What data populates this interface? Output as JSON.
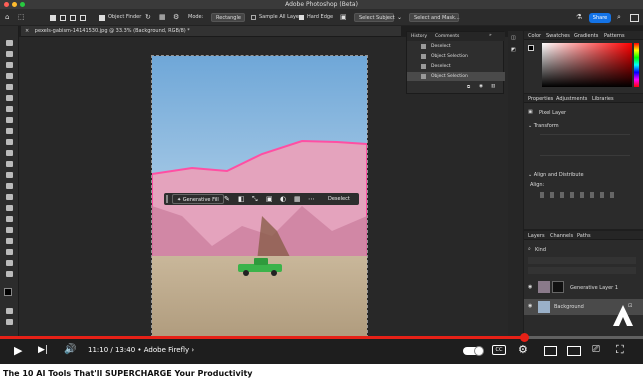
{
  "window": {
    "title": "Adobe Photoshop (Beta)"
  },
  "options": {
    "object_finder": "Object Finder",
    "mode_label": "Mode:",
    "mode_value": "Rectangle",
    "sample_all_layers": "Sample All Layers",
    "hard_edge": "Hard Edge",
    "select_subject": "Select Subject",
    "select_and_mask": "Select and Mask..."
  },
  "share_label": "Share",
  "document": {
    "tab_title": "pexels-gabism-14141530.jpg @ 33.3% (Background, RGB/8) *"
  },
  "history": {
    "tabs": [
      "History",
      "Comments"
    ],
    "items": [
      "Deselect",
      "Object Selection",
      "Deselect",
      "Object Selection"
    ]
  },
  "contextual_bar": {
    "generative_fill": "Generative Fill",
    "deselect": "Deselect"
  },
  "color_panel": {
    "tabs": [
      "Color",
      "Swatches",
      "Gradients",
      "Patterns"
    ]
  },
  "properties": {
    "tabs": [
      "Properties",
      "Adjustments",
      "Libraries"
    ],
    "layer_type": "Pixel Layer",
    "transform": "Transform",
    "align": "Align and Distribute",
    "align_label": "Align:"
  },
  "layers": {
    "tabs": [
      "Layers",
      "Channels",
      "Paths"
    ],
    "kind": "Kind",
    "items": [
      "Generative Layer 1",
      "Background"
    ]
  },
  "player": {
    "time": "11:10 / 13:40",
    "chapter": "Adobe Firefly",
    "progress": 0.8146
  },
  "video_title": "The 10 AI Tools That'll SUPERCHARGE Your Productivity",
  "colors": {
    "accent": "#1473e6",
    "yt_red": "#e62117",
    "selection": "#ff4fa3",
    "car": "#3bb34a"
  }
}
